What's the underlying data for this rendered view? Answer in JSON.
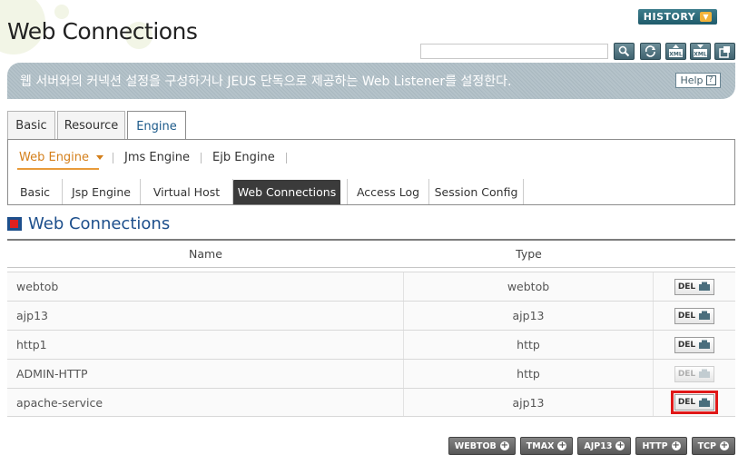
{
  "header": {
    "title": "Web Connections",
    "history_label": "HISTORY",
    "search_value": "",
    "toolbar_icons": [
      "search-icon",
      "refresh-icon",
      "xml-export-icon",
      "xml-import-icon",
      "config-icon"
    ]
  },
  "description": {
    "text": "웹 서버와의 커넥션 설정을 구성하거나 JEUS 단독으로 제공하는 Web Listener를 설정한다.",
    "help_label": "Help"
  },
  "main_tabs": [
    {
      "label": "Basic"
    },
    {
      "label": "Resource"
    },
    {
      "label": "Engine"
    }
  ],
  "engine_tabs": [
    {
      "label": "Web Engine"
    },
    {
      "label": "Jms Engine"
    },
    {
      "label": "Ejb Engine"
    }
  ],
  "web_tabs": [
    {
      "label": "Basic"
    },
    {
      "label": "Jsp Engine"
    },
    {
      "label": "Virtual Host"
    },
    {
      "label": "Web Connections"
    },
    {
      "label": "Access Log"
    },
    {
      "label": "Session Config"
    }
  ],
  "section_title": "Web Connections",
  "table": {
    "columns": [
      "Name",
      "Type"
    ],
    "rows": [
      {
        "name": "webtob",
        "type": "webtob",
        "action": "DEL"
      },
      {
        "name": "ajp13",
        "type": "ajp13",
        "action": "DEL"
      },
      {
        "name": "http1",
        "type": "http",
        "action": "DEL"
      },
      {
        "name": "ADMIN-HTTP",
        "type": "http",
        "action": "DEL"
      },
      {
        "name": "apache-service",
        "type": "ajp13",
        "action": "DEL"
      }
    ]
  },
  "add_buttons": [
    "WEBTOB",
    "TMAX",
    "AJP13",
    "HTTP",
    "TCP"
  ],
  "colors": {
    "accent_blue": "#1d4f8c",
    "active_orange": "#d47f1a",
    "highlight_red": "#e01818"
  }
}
